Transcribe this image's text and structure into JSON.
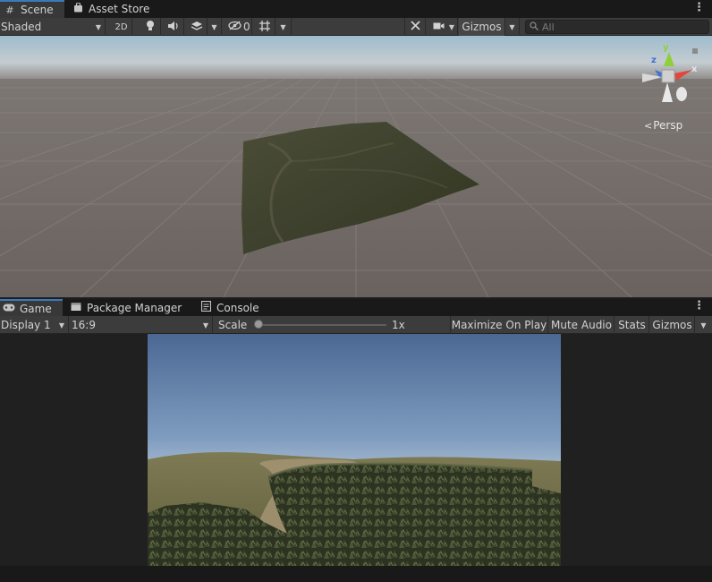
{
  "scene_tabs": {
    "scene": "Scene",
    "asset_store": "Asset Store"
  },
  "scene_toolbar": {
    "draw_mode": "Shaded",
    "mode_2d": "2D",
    "hidden_count": "0",
    "gizmos": "Gizmos",
    "search_placeholder": "All"
  },
  "scene_view": {
    "projection_label": "Persp",
    "axis_x": "x",
    "axis_y": "y",
    "axis_z": "z"
  },
  "game_tabs": {
    "game": "Game",
    "package_manager": "Package Manager",
    "console": "Console"
  },
  "game_toolbar": {
    "display": "Display 1",
    "aspect": "16:9",
    "scale_label": "Scale",
    "scale_value": "1x",
    "scale_fraction": 0.0,
    "maximize_on_play": "Maximize On Play",
    "mute_audio": "Mute Audio",
    "stats": "Stats",
    "gizmos": "Gizmos"
  },
  "colors": {
    "accent_tab": "#3a79bb",
    "axis_x": "#e0473a",
    "axis_y": "#8fcf3a",
    "axis_z": "#3f71d8",
    "panel_bg": "#383838",
    "toolbar_bg": "#3c3c3c"
  }
}
